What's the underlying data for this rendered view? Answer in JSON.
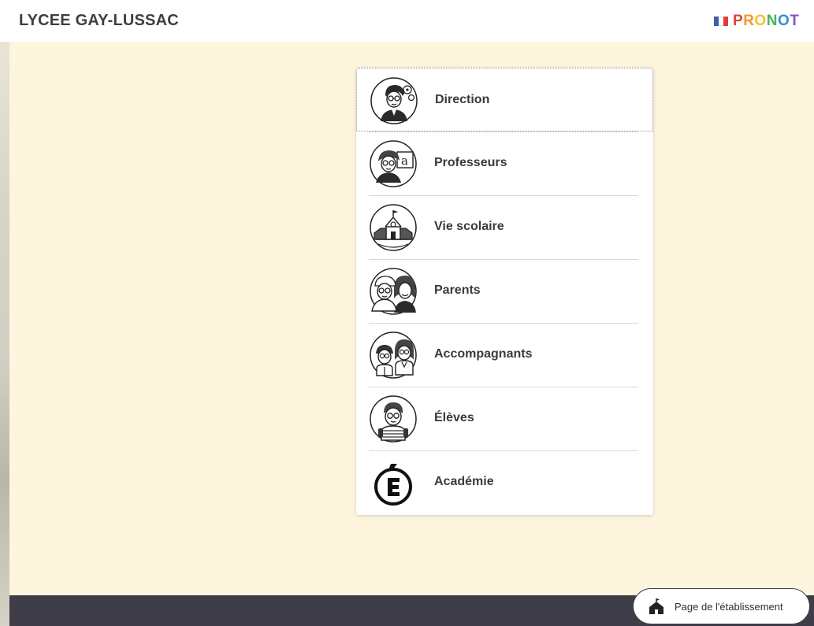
{
  "header": {
    "school_name": "LYCEE GAY-LUSSAC",
    "brand": {
      "name": "PRONOTE",
      "visible_text": "PRONOT",
      "letter_colors": [
        "#e5403c",
        "#f09a2a",
        "#f2c12e",
        "#43b35a",
        "#2f8fd8",
        "#8a4fc7",
        "#e5403c"
      ],
      "flag_colors": [
        "#3b5ca8",
        "#ffffff",
        "#e03c3c"
      ]
    }
  },
  "profiles": [
    {
      "label": "Direction",
      "icon": "director-icon"
    },
    {
      "label": "Professeurs",
      "icon": "teacher-icon"
    },
    {
      "label": "Vie scolaire",
      "icon": "school-building-icon"
    },
    {
      "label": "Parents",
      "icon": "parents-icon"
    },
    {
      "label": "Accompagnants",
      "icon": "companions-icon"
    },
    {
      "label": "Élèves",
      "icon": "student-icon"
    },
    {
      "label": "Académie",
      "icon": "academie-e-logo"
    }
  ],
  "footer": {
    "establishment_button": {
      "label": "Page de l'établissement",
      "icon": "school-house-icon"
    }
  },
  "colors": {
    "background": "#fdf5de",
    "footer": "#3f3e48",
    "text": "#3a3a40"
  }
}
